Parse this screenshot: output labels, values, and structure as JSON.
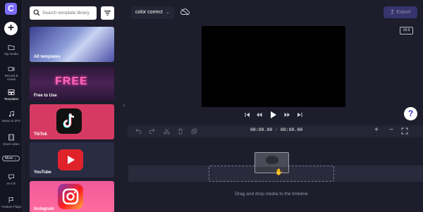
{
  "app": {
    "logo_letter": "C",
    "add_symbol": "+"
  },
  "rail": {
    "items": [
      {
        "label": "My media",
        "icon": "folder-icon"
      },
      {
        "label": "Record & create",
        "icon": "video-record-icon"
      },
      {
        "label": "Templates",
        "icon": "templates-icon",
        "active": true
      },
      {
        "label": "Music & SFX",
        "icon": "music-icon"
      },
      {
        "label": "Stock video",
        "icon": "film-icon"
      },
      {
        "label": "en-US",
        "icon": "language-icon"
      },
      {
        "label": "Feature Flags",
        "icon": "flag-icon"
      }
    ],
    "more_label": "More ⌄"
  },
  "panel": {
    "search_placeholder": "Search template library",
    "filter_icon": "filter-icon",
    "cards": [
      {
        "label": "All templates"
      },
      {
        "label": "Free to Use",
        "art_text": "FREE"
      },
      {
        "label": "TikTok"
      },
      {
        "label": "YouTube"
      },
      {
        "label": "Instagram"
      }
    ],
    "collapse_glyph": "‹"
  },
  "header": {
    "project_name": "color correct",
    "project_chevron": "⌄",
    "cloud_icon": "cloud-offline-icon",
    "export_label": "Export",
    "export_icon": "upload-icon"
  },
  "preview": {
    "aspect_ratio": "16:9",
    "help_label": "?"
  },
  "timeline": {
    "time_current": "00:00.00",
    "time_separator": " / ",
    "time_total": "00:00.00",
    "drop_hint": "Drag and drop media to the timeline",
    "zoom_minus": "−",
    "zoom_plus": "+"
  },
  "colors": {
    "accent": "#7b6cff",
    "background": "#1d1d2c",
    "rail": "#151522",
    "export": "#4a47a3"
  }
}
